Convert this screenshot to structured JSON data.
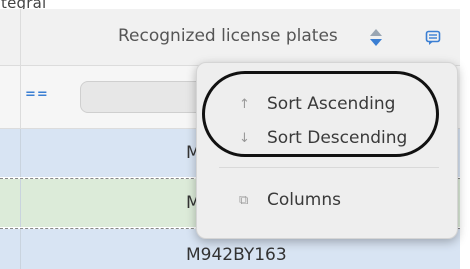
{
  "top_label": "tegral",
  "header": {
    "column_title": "Recognized license plates",
    "sort_icon": "sort-up-down-icon",
    "menu_icon": "column-menu-icon"
  },
  "filter": {
    "operator": "==",
    "value": ""
  },
  "rows": [
    {
      "plate": "M"
    },
    {
      "plate": "M"
    },
    {
      "plate": "M942BY163"
    }
  ],
  "menu": {
    "sort_ascending": {
      "icon": "↑",
      "label": "Sort Ascending"
    },
    "sort_descending": {
      "icon": "↓",
      "label": "Sort Descending"
    },
    "columns": {
      "icon": "⧉",
      "label": "Columns"
    }
  },
  "colors": {
    "accent": "#3b7fd3",
    "row_blue": "#d8e4f3",
    "row_green": "#dcebd9",
    "highlight": "#111111"
  }
}
